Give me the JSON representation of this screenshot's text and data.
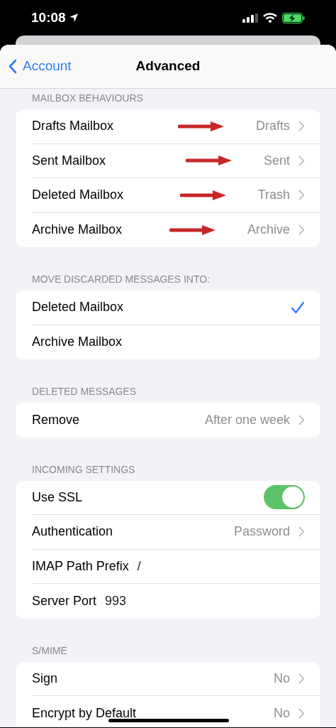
{
  "status_bar": {
    "time": "10:08"
  },
  "nav": {
    "back": "Account",
    "title": "Advanced"
  },
  "sections": [
    {
      "header": "MAILBOX BEHAVIOURS",
      "rows": [
        {
          "kind": "link",
          "label": "Drafts Mailbox",
          "value": "Drafts",
          "arrow": true
        },
        {
          "kind": "link",
          "label": "Sent Mailbox",
          "value": "Sent",
          "arrow": true
        },
        {
          "kind": "link",
          "label": "Deleted Mailbox",
          "value": "Trash",
          "arrow": true
        },
        {
          "kind": "link",
          "label": "Archive Mailbox",
          "value": "Archive",
          "arrow": true
        }
      ]
    },
    {
      "header": "MOVE DISCARDED MESSAGES INTO:",
      "rows": [
        {
          "kind": "check",
          "label": "Deleted Mailbox",
          "selected": true
        },
        {
          "kind": "check",
          "label": "Archive Mailbox",
          "selected": false
        }
      ]
    },
    {
      "header": "DELETED MESSAGES",
      "rows": [
        {
          "kind": "link",
          "label": "Remove",
          "value": "After one week",
          "arrow": false
        }
      ]
    },
    {
      "header": "INCOMING SETTINGS",
      "rows": [
        {
          "kind": "toggle",
          "label": "Use SSL",
          "on": true
        },
        {
          "kind": "link",
          "label": "Authentication",
          "value": "Password",
          "arrow": false
        },
        {
          "kind": "field",
          "label": "IMAP Path Prefix",
          "value": "/"
        },
        {
          "kind": "field",
          "label": "Server Port",
          "value": "993"
        }
      ]
    },
    {
      "header": "S/MIME",
      "rows": [
        {
          "kind": "link",
          "label": "Sign",
          "value": "No",
          "arrow": false
        },
        {
          "kind": "link",
          "label": "Encrypt by Default",
          "value": "No",
          "arrow": false
        }
      ]
    }
  ]
}
